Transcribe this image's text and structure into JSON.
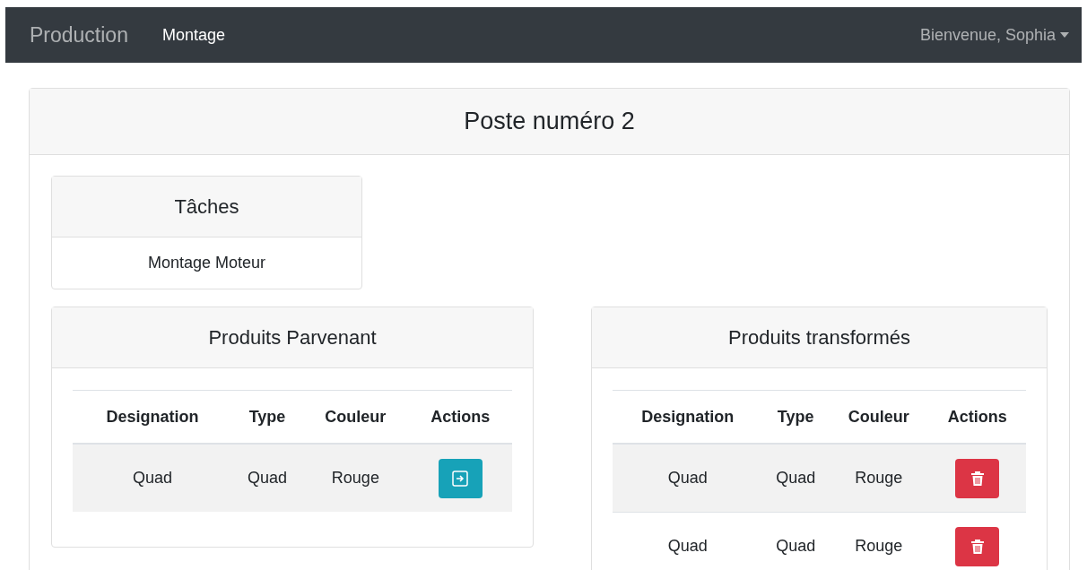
{
  "navbar": {
    "brand": "Production",
    "links": [
      {
        "label": "Montage",
        "selected": true
      }
    ],
    "user_menu": "Bienvenue, Sophia"
  },
  "poste": {
    "title": "Poste numéro 2",
    "taches": {
      "title": "Tâches",
      "items": [
        "Montage Moteur"
      ]
    },
    "tables": [
      {
        "title": "Produits Parvenant",
        "kind": "transfer",
        "columns": [
          "Designation",
          "Type",
          "Couleur",
          "Actions"
        ],
        "rows": [
          [
            "Quad",
            "Quad",
            "Rouge"
          ]
        ]
      },
      {
        "title": "Produits transformés",
        "kind": "delete",
        "columns": [
          "Designation",
          "Type",
          "Couleur",
          "Actions"
        ],
        "rows": [
          [
            "Quad",
            "Quad",
            "Rouge"
          ],
          [
            "Quad",
            "Quad",
            "Rouge"
          ]
        ]
      }
    ]
  }
}
